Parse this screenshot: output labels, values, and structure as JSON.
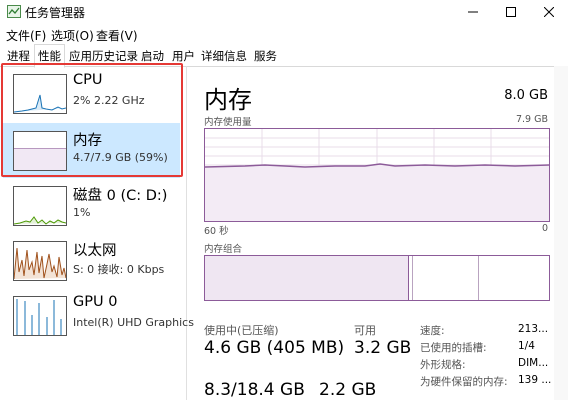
{
  "window": {
    "title": "任务管理器"
  },
  "menu": [
    "文件(F)",
    "选项(O)",
    "查看(V)"
  ],
  "tabs": [
    "进程",
    "性能",
    "应用历史记录",
    "启动",
    "用户",
    "详细信息",
    "服务"
  ],
  "active_tab": "性能",
  "resources": [
    {
      "name": "CPU",
      "sub": "2% 2.22 GHz",
      "selected": false,
      "icon": "cpu-graph"
    },
    {
      "name": "内存",
      "sub": "4.7/7.9 GB (59%)",
      "selected": true,
      "icon": "memory-graph"
    },
    {
      "name": "磁盘 0 (C: D:)",
      "sub": "1%",
      "selected": false,
      "icon": "disk-graph"
    },
    {
      "name": "以太网",
      "sub": "S: 0 接收: 0 Kbps",
      "selected": false,
      "icon": "ethernet-graph"
    },
    {
      "name": "GPU 0",
      "sub": "Intel(R) UHD Graphics",
      "selected": false,
      "icon": "gpu-graph"
    }
  ],
  "detail": {
    "title": "内存",
    "total": "8.0 GB",
    "usage_label": "内存使用量",
    "usage_max": "7.9 GB",
    "time_left": "60 秒",
    "time_right": "0",
    "composition_label": "内存组合",
    "stats": {
      "in_use_label": "使用中(已压缩)",
      "in_use_value": "4.6 GB (405 MB)",
      "available_label": "可用",
      "available_value": "3.2 GB",
      "committed_value": "8.3/18.4 GB",
      "cached_value": "2.2 GB"
    },
    "side": [
      {
        "label": "速度:",
        "value": "213..."
      },
      {
        "label": "已使用的插槽:",
        "value": "1/4"
      },
      {
        "label": "外形规格:",
        "value": "DIM..."
      },
      {
        "label": "为硬件保留的内存:",
        "value": "139 ..."
      }
    ]
  },
  "colors": {
    "memory_line": "#8c5b99",
    "cpu_line": "#1a73b5",
    "disk_line": "#4e9a06",
    "ethernet_line": "#a0521d",
    "selected_bg": "#cce8ff",
    "highlight_box": "#e53935"
  }
}
